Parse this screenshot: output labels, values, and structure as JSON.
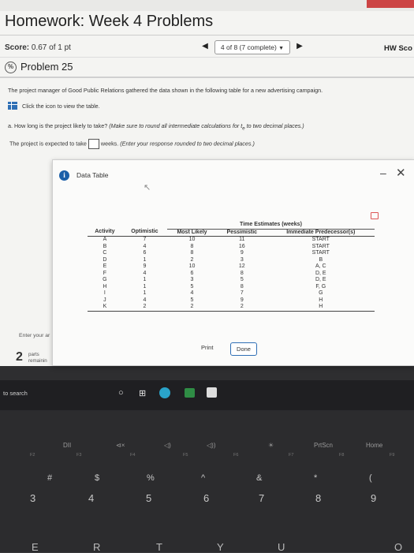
{
  "header": {
    "title": "Homework: Week 4 Problems",
    "score_label": "Score:",
    "score_value": "0.67 of 1 pt",
    "nav_position": "4 of 8 (7 complete)",
    "hw_score_label": "HW Sco"
  },
  "problem": {
    "icon_text": "%",
    "title": "Problem 25",
    "intro": "The project manager of Good Public Relations gathered the data shown in the following table for a new advertising campaign.",
    "table_link": "Click the icon to view the table.",
    "question_prefix": "a. How long is the project likely to take?",
    "question_italic": "(Make sure to round all intermediate calculations for t",
    "question_subscript": "e",
    "question_italic_end": " to two decimal places.)",
    "answer_prefix": "The project is expected to take",
    "answer_suffix": "weeks.",
    "answer_instruction": "(Enter your response rounded to two decimal places.)",
    "enter_answer": "Enter your ar",
    "parts_count": "2",
    "parts_label": "parts",
    "parts_remaining": "remainin"
  },
  "dialog": {
    "title": "Data Table",
    "min_icon": "–",
    "close_icon": "✕",
    "print_label": "Print",
    "done_label": "Done"
  },
  "table": {
    "group_header": "Time Estimates (weeks)",
    "columns": [
      "Activity",
      "Optimistic",
      "Most Likely",
      "Pessimistic",
      "Immediate Predecessor(s)"
    ],
    "rows": [
      [
        "A",
        "7",
        "10",
        "11",
        "START"
      ],
      [
        "B",
        "4",
        "8",
        "16",
        "START"
      ],
      [
        "C",
        "6",
        "8",
        "9",
        "START"
      ],
      [
        "D",
        "1",
        "2",
        "3",
        "B"
      ],
      [
        "E",
        "9",
        "10",
        "12",
        "A, C"
      ],
      [
        "F",
        "4",
        "6",
        "8",
        "D, E"
      ],
      [
        "G",
        "1",
        "3",
        "5",
        "D, E"
      ],
      [
        "H",
        "1",
        "5",
        "8",
        "F, G"
      ],
      [
        "I",
        "1",
        "4",
        "7",
        "G"
      ],
      [
        "J",
        "4",
        "5",
        "9",
        "H"
      ],
      [
        "K",
        "2",
        "2",
        "2",
        "H"
      ]
    ]
  },
  "taskbar": {
    "search_text": "to search"
  },
  "keyboard": {
    "fkeys": [
      "DII",
      "⊲×",
      "◁)",
      "◁))",
      "☀",
      "PrtScn",
      "Home"
    ],
    "fsub": [
      "F2",
      "F3",
      "F4",
      "F5",
      "F6",
      "F7",
      "F8",
      "F9"
    ],
    "symbols": [
      "#",
      "$",
      "%",
      "^",
      "&",
      "*",
      "("
    ],
    "numbers": [
      "3",
      "4",
      "5",
      "6",
      "7",
      "8",
      "9"
    ],
    "letters": [
      "E",
      "R",
      "T",
      "Y",
      "U",
      "O"
    ]
  },
  "colors": {
    "accent": "#2f6fb5",
    "info_icon": "#1b5fa8"
  }
}
